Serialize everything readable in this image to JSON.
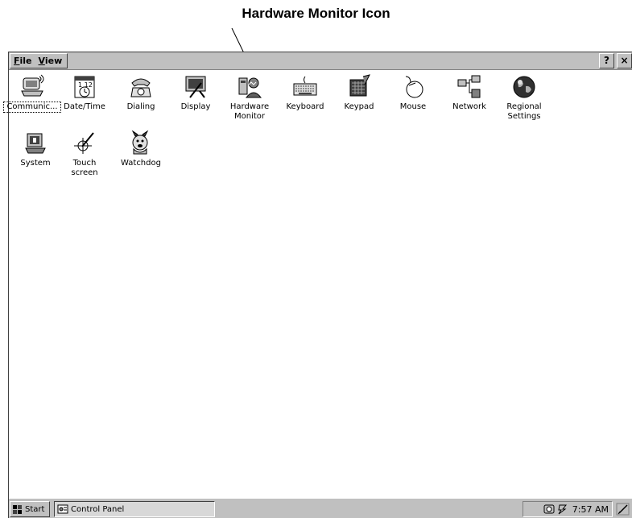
{
  "callout": {
    "text": "Hardware Monitor Icon"
  },
  "menu": {
    "file_prefix": "",
    "file_underline": "F",
    "file_rest": "ile",
    "view_underline": "V",
    "view_rest": "iew"
  },
  "toolbar": {
    "help_label": "?",
    "close_label": "×"
  },
  "items": [
    {
      "label": "Communic...",
      "icon": "communications-icon",
      "selected": true
    },
    {
      "label": "Date/Time",
      "icon": "date-time-icon"
    },
    {
      "label": "Dialing",
      "icon": "dialing-icon"
    },
    {
      "label": "Display",
      "icon": "display-icon"
    },
    {
      "label": "Hardware Monitor",
      "label_line1": "Hardware",
      "label_line2": "Monitor",
      "icon": "hardware-monitor-icon"
    },
    {
      "label": "Keyboard",
      "icon": "keyboard-icon"
    },
    {
      "label": "Keypad",
      "icon": "keypad-icon"
    },
    {
      "label": "Mouse",
      "icon": "mouse-icon"
    },
    {
      "label": "Network",
      "icon": "network-icon"
    },
    {
      "label": "Regional Settings",
      "label_line1": "Regional",
      "label_line2": "Settings",
      "icon": "globe-icon"
    },
    {
      "label": "System",
      "icon": "system-icon"
    },
    {
      "label": "Touch screen",
      "label_line1": "Touch",
      "label_line2": "screen",
      "icon": "touch-screen-icon"
    },
    {
      "label": "Watchdog",
      "icon": "watchdog-icon"
    }
  ],
  "taskbar": {
    "start_label": "Start",
    "task_label": "Control Panel",
    "clock": "7:57 AM"
  }
}
